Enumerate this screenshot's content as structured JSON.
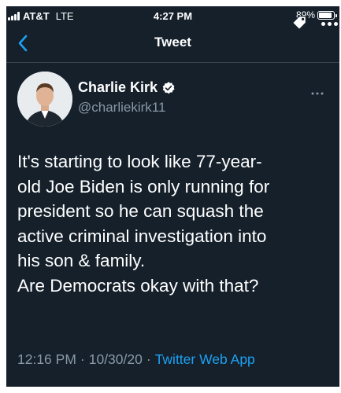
{
  "status_bar": {
    "carrier": "AT&T",
    "network": "LTE",
    "time": "4:27 PM",
    "battery": "89%",
    "battery_level": 0.89
  },
  "nav": {
    "back_icon": "chevron-left-icon",
    "title": "Tweet"
  },
  "tweet": {
    "author_name": "Charlie Kirk",
    "author_handle": "@charliekirk11",
    "verified_icon": "verified-badge-icon",
    "more_icon": "more-dots-icon",
    "body_lines": [
      "It's starting to look like 77-year-",
      "old Joe Biden is only running for",
      "president so he can squash the",
      "active criminal investigation into",
      "his son & family."
    ],
    "body_question": "Are Democrats okay with that?",
    "time": "12:16 PM",
    "separator": "·",
    "date": "10/30/20",
    "source": "Twitter Web App"
  },
  "colors": {
    "background": "#15202b",
    "secondary_text": "#8899a6",
    "accent": "#1da1f2",
    "divider": "#38444d"
  }
}
